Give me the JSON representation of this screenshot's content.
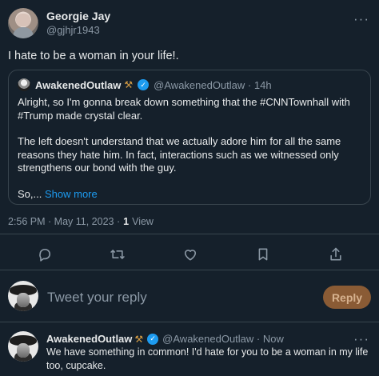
{
  "tweet": {
    "author": {
      "display_name": "Georgie Jay",
      "handle": "@gjhjr1943"
    },
    "more_icon": "more-options-icon",
    "text": "I hate to be a woman in your life!.",
    "timestamp": "2:56 PM · May 11, 2023 ·",
    "views_count": "1",
    "views_label": "View"
  },
  "quote": {
    "display_name": "AwakenedOutlaw",
    "emoji": "⚒",
    "handle_time": "@AwakenedOutlaw · 14h",
    "body": [
      "Alright, so I'm gonna break down something that the #CNNTownhall with #Trump made crystal clear.",
      "The left doesn't understand that we actually adore him for all the same reasons they hate him. In fact, interactions such as we witnessed only strengthens our bond with the guy."
    ],
    "truncated_prefix": "So,...",
    "show_more_label": "Show more"
  },
  "actions": [
    {
      "name": "reply-icon"
    },
    {
      "name": "retweet-icon"
    },
    {
      "name": "like-icon"
    },
    {
      "name": "bookmark-icon"
    },
    {
      "name": "share-icon"
    }
  ],
  "composer": {
    "placeholder": "Tweet your reply",
    "button_label": "Reply",
    "button_color": "#8a5b35"
  },
  "reply": {
    "display_name": "AwakenedOutlaw",
    "emoji": "⚒",
    "handle_time": "@AwakenedOutlaw · Now",
    "text": "We have something in common!  I'd hate for you to be a woman in my life too, cupcake."
  },
  "colors": {
    "background": "#15202b",
    "text": "#e7e9ea",
    "secondary": "#8b98a5",
    "accent": "#1d9bf0",
    "border": "#38444d"
  }
}
